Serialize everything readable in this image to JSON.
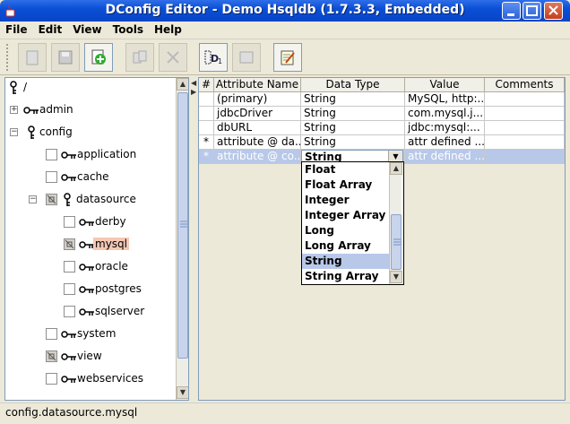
{
  "window": {
    "title": "DConfig Editor - Demo Hsqldb (1.7.3.3, Embedded)"
  },
  "menu": [
    "File",
    "Edit",
    "View",
    "Tools",
    "Help"
  ],
  "toolbar": {
    "icons": [
      "new-icon",
      "save-icon",
      "add-node-icon",
      "copy-icon",
      "delete-icon",
      "d1-icon",
      "rename-icon",
      "edit-note-icon"
    ]
  },
  "tree": {
    "root": "/",
    "items": [
      {
        "label": "admin"
      },
      {
        "label": "config"
      },
      {
        "label": "application"
      },
      {
        "label": "cache"
      },
      {
        "label": "datasource"
      },
      {
        "label": "derby"
      },
      {
        "label": "mysql"
      },
      {
        "label": "oracle"
      },
      {
        "label": "postgres"
      },
      {
        "label": "sqlserver"
      },
      {
        "label": "system"
      },
      {
        "label": "view"
      },
      {
        "label": "webservices"
      }
    ]
  },
  "table": {
    "headers": [
      "#",
      "Attribute Name",
      "Data Type",
      "Value",
      "Comments"
    ],
    "rows": [
      {
        "mark": "",
        "name": "(primary)",
        "type": "String",
        "value": "MySQL, http:...",
        "comments": ""
      },
      {
        "mark": "",
        "name": "jdbcDriver",
        "type": "String",
        "value": "com.mysql.j...",
        "comments": ""
      },
      {
        "mark": "",
        "name": "dbURL",
        "type": "String",
        "value": "jdbc:mysql:...",
        "comments": ""
      },
      {
        "mark": "*",
        "name": "attribute @ da...",
        "type": "String",
        "value": "attr defined ...",
        "comments": ""
      },
      {
        "mark": "*",
        "name": "attribute @ co...",
        "type": "String",
        "value": "attr defined ...",
        "comments": ""
      }
    ]
  },
  "dropdown": {
    "selected": "String",
    "options": [
      "Float",
      "Float Array",
      "Integer",
      "Integer Array",
      "Long",
      "Long Array",
      "String",
      "String Array"
    ]
  },
  "status": {
    "path": "config.datasource.mysql"
  },
  "colors": {
    "titlebar": "#0a4fd6",
    "selection": "#b8c8e8",
    "tree_selection": "#f3c8b4"
  }
}
